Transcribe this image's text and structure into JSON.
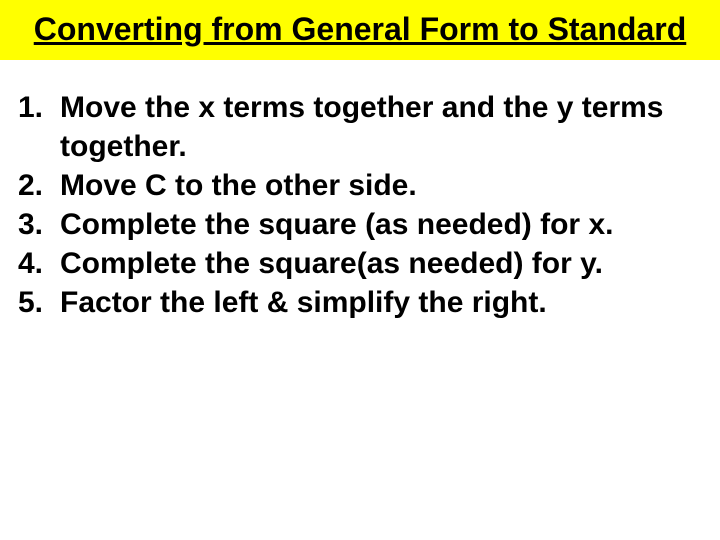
{
  "title": "Converting from General Form to Standard",
  "steps": [
    {
      "num": "1.",
      "text": "Move the x terms together and the y terms together."
    },
    {
      "num": "2.",
      "text": "Move C  to the other side."
    },
    {
      "num": "3.",
      "text": "Complete the square (as needed) for x."
    },
    {
      "num": "4.",
      "text": "Complete the square(as needed) for y."
    },
    {
      "num": "5.",
      "text": "Factor the left & simplify the right."
    }
  ]
}
